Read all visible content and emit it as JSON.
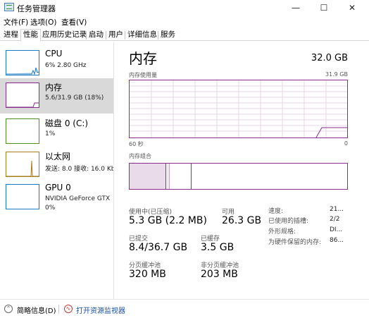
{
  "window": {
    "title": "任务管理器",
    "minimize": "—",
    "maximize": "☐",
    "close": "✕"
  },
  "menu": [
    "文件(F)",
    "选项(O)",
    "查看(V)"
  ],
  "tabs": [
    "进程",
    "性能",
    "应用历史记录",
    "启动",
    "用户",
    "详细信息",
    "服务"
  ],
  "active_tab": "性能",
  "sidebar": [
    {
      "name": "CPU",
      "detail": "6% 2.80 GHz",
      "detail2": "",
      "color": "#1a78c2"
    },
    {
      "name": "内存",
      "detail": "5.6/31.9 GB (18%)",
      "detail2": "",
      "color": "#8b2b8b"
    },
    {
      "name": "磁盘 0 (C:)",
      "detail": "1%",
      "detail2": "",
      "color": "#4d8f1e"
    },
    {
      "name": "以太网",
      "detail": "发送: 8.0  接收: 16.0 Kb",
      "detail2": "",
      "color": "#a67c1a"
    },
    {
      "name": "GPU 0",
      "detail": "NVIDIA GeForce GTX",
      "detail2": "0%",
      "color": "#1a78c2"
    }
  ],
  "main": {
    "title": "内存",
    "total": "32.0 GB",
    "usage_label": "内存使用量",
    "usage_max": "31.9 GB",
    "time_left": "60 秒",
    "time_right": "0",
    "composition_label": "内存组合",
    "accent": "#8b2b8b"
  },
  "stats": {
    "in_use_label": "使用中(已压缩)",
    "in_use_value": "5.3 GB (2.2 MB)",
    "available_label": "可用",
    "available_value": "26.3 GB",
    "committed_label": "已提交",
    "committed_value": "8.4/36.7 GB",
    "cached_label": "已缓存",
    "cached_value": "3.5 GB",
    "paged_label": "分页缓冲池",
    "paged_value": "320 MB",
    "nonpaged_label": "非分页缓冲池",
    "nonpaged_value": "203 MB"
  },
  "properties": [
    {
      "label": "速度:",
      "value": "21..."
    },
    {
      "label": "已使用的插槽:",
      "value": "2/2"
    },
    {
      "label": "外形规格:",
      "value": "DI..."
    },
    {
      "label": "为硬件保留的内存:",
      "value": "86..."
    }
  ],
  "footer": {
    "summary": "简略信息(D)",
    "monitor": "打开资源监视器"
  }
}
